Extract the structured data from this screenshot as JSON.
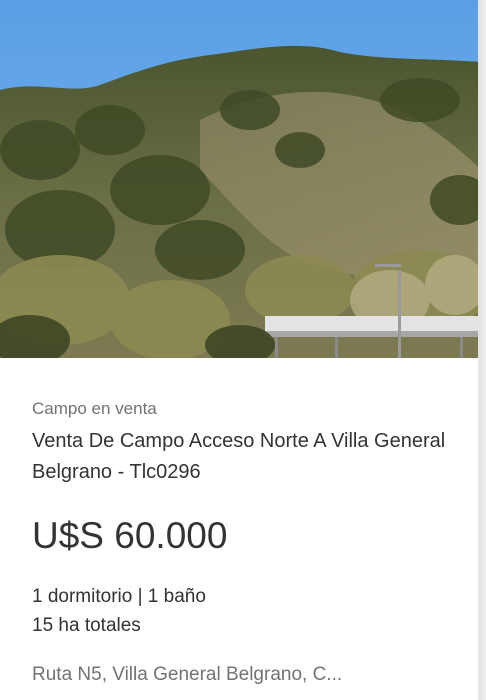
{
  "listing": {
    "category": "Campo en venta",
    "title": "Venta De Campo Acceso Norte A Villa General Belgrano - Tlc0296",
    "price": "U$S 60.000",
    "attributes": {
      "rooms_line": "1 dormitorio | 1 baño",
      "area_line": "15 ha totales"
    },
    "location": "Ruta N5, Villa General Belgrano, C..."
  },
  "colors": {
    "text_primary": "#333333",
    "text_secondary": "#737373",
    "sky": "#5a9fe6",
    "vegetation": "#55603a"
  }
}
